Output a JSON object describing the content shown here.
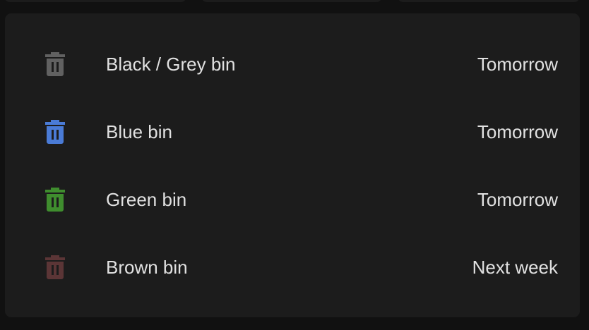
{
  "bins": [
    {
      "label": "Black / Grey bin",
      "when": "Tomorrow",
      "icon": "trash-can-icon",
      "color": "#616161"
    },
    {
      "label": "Blue bin",
      "when": "Tomorrow",
      "icon": "trash-can-icon",
      "color": "#4a7bd6"
    },
    {
      "label": "Green bin",
      "when": "Tomorrow",
      "icon": "trash-can-icon",
      "color": "#3f8d2e"
    },
    {
      "label": "Brown bin",
      "when": "Next week",
      "icon": "trash-can-icon",
      "color": "#5b3536"
    }
  ],
  "colors": {
    "page_background": "#111111",
    "card_background": "#1c1c1c",
    "text": "#e1e1e1"
  }
}
